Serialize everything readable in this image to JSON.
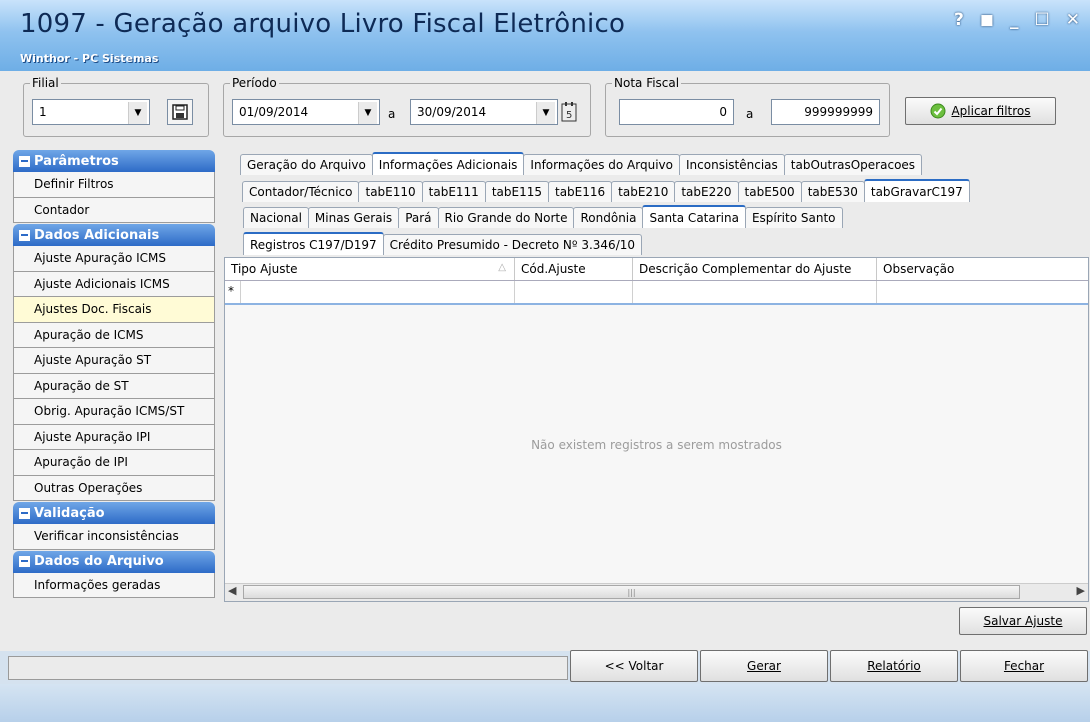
{
  "window": {
    "title": "1097 - Geração arquivo Livro Fiscal Eletrônico",
    "subtitle": "Winthor - PC Sistemas",
    "controls": [
      "?",
      "◼",
      "_",
      "☐",
      "✕"
    ]
  },
  "filters": {
    "filial": {
      "label": "Filial",
      "value": "1"
    },
    "periodo": {
      "label": "Período",
      "from": "01/09/2014",
      "sep": "a",
      "to": "30/09/2014"
    },
    "nota": {
      "label": "Nota Fiscal",
      "from": "0",
      "sep": "a",
      "to": "999999999"
    },
    "apply_label": "Aplicar filtros"
  },
  "sidebar": {
    "parametros": {
      "title": "Parâmetros",
      "items": [
        "Definir Filtros",
        "Contador"
      ]
    },
    "dados_adicionais": {
      "title": "Dados Adicionais",
      "items": [
        "Ajuste Apuração ICMS",
        "Ajuste Adicionais ICMS",
        "Ajustes Doc. Fiscais",
        "Apuração de ICMS",
        "Ajuste Apuração ST",
        "Apuração de ST",
        "Obrig. Apuração ICMS/ST",
        "Ajuste Apuração IPI",
        "Apuração de IPI",
        "Outras Operações"
      ]
    },
    "validacao": {
      "title": "Validação",
      "items": [
        "Verificar inconsistências"
      ]
    },
    "dados_arquivo": {
      "title": "Dados do Arquivo",
      "items": [
        "Informações geradas"
      ]
    }
  },
  "tabs": {
    "row1": [
      "Geração do Arquivo",
      "Informações Adicionais",
      "Informações do Arquivo",
      "Inconsistências",
      "tabOutrasOperacoes"
    ],
    "row2": [
      "Contador/Técnico",
      "tabE110",
      "tabE111",
      "tabE115",
      "tabE116",
      "tabE210",
      "tabE220",
      "tabE500",
      "tabE530",
      "tabGravarC197"
    ],
    "row3": [
      "Nacional",
      "Minas Gerais",
      "Pará",
      "Rio Grande do Norte",
      "Rondônia",
      "Santa Catarina",
      "Espírito Santo"
    ],
    "row4": [
      "Registros C197/D197",
      "Crédito Presumido - Decreto Nº 3.346/10"
    ]
  },
  "grid": {
    "columns": [
      "Tipo Ajuste",
      "Cód.Ajuste",
      "Descrição Complementar do Ajuste",
      "Observação"
    ],
    "new_row_marker": "*",
    "empty_message": "Não existem registros a serem mostrados"
  },
  "buttons": {
    "salvar": "Salvar Ajuste",
    "voltar": "<< Voltar",
    "gerar": "Gerar",
    "relatorio": "Relatório",
    "fechar": "Fechar"
  }
}
